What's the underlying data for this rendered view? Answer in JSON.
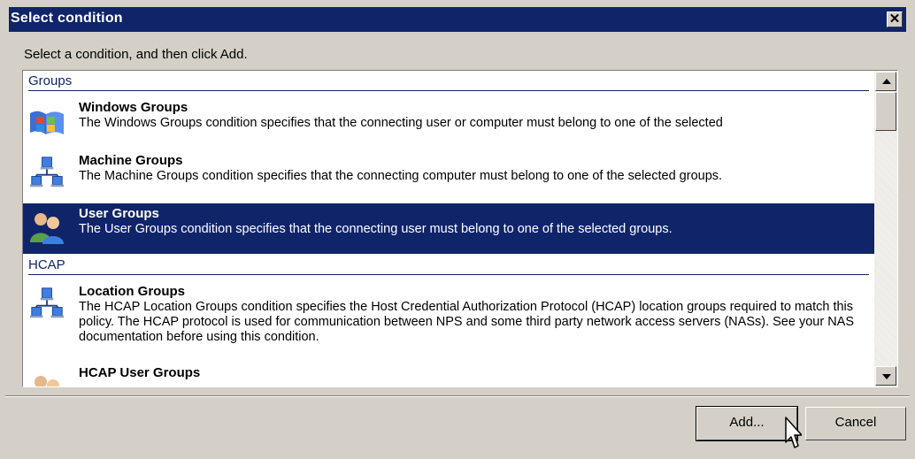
{
  "window": {
    "title": "Select condition",
    "close_glyph": "✕"
  },
  "instruction": "Select a condition, and then click Add.",
  "groups": [
    {
      "header": "Groups",
      "items": [
        {
          "name": "Windows Groups",
          "description": "The Windows Groups condition specifies that the connecting user or computer must belong to one of the selected",
          "icon": "windows-groups-icon",
          "selected": false
        },
        {
          "name": "Machine Groups",
          "description": "The Machine Groups condition specifies that the connecting computer must belong to one of the selected groups.",
          "icon": "machine-groups-icon",
          "selected": false
        },
        {
          "name": "User Groups",
          "description": "The User Groups condition specifies that the connecting user must belong to one of the selected groups.",
          "icon": "user-groups-icon",
          "selected": true
        }
      ]
    },
    {
      "header": "HCAP",
      "items": [
        {
          "name": "Location Groups",
          "description": "The HCAP Location Groups condition specifies the Host Credential Authorization Protocol (HCAP) location groups required to match this policy. The HCAP protocol is used for communication between NPS and some third party network access servers (NASs). See your NAS documentation before using this condition.",
          "icon": "location-groups-icon",
          "selected": false
        },
        {
          "name": "HCAP User Groups",
          "description": "",
          "icon": "hcap-user-groups-icon",
          "selected": false
        }
      ]
    }
  ],
  "buttons": {
    "add_label": "Add...",
    "cancel_label": "Cancel"
  },
  "colors": {
    "selection": "#10246a",
    "face": "#d4d0c8",
    "title_bar": "#10246a"
  }
}
